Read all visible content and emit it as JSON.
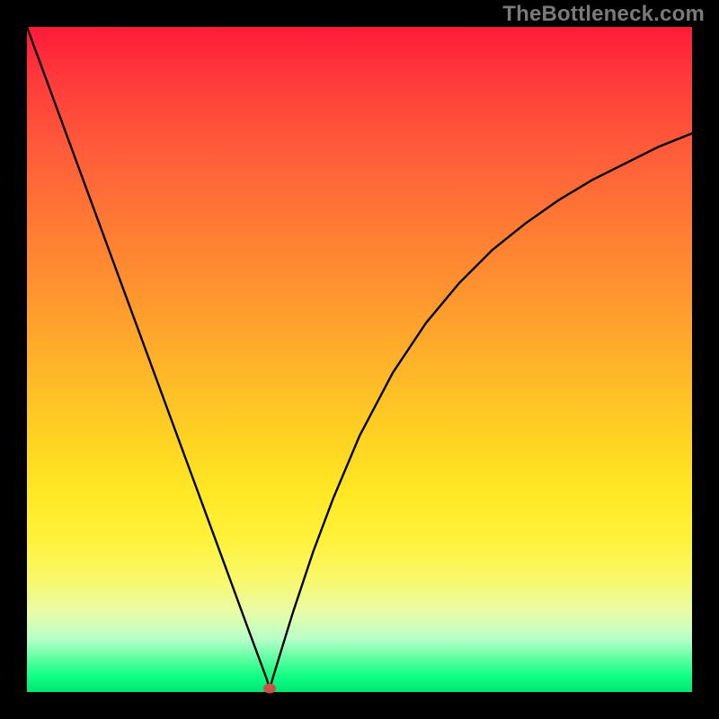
{
  "watermark": "TheBottleneck.com",
  "chart_data": {
    "type": "line",
    "title": "",
    "xlabel": "",
    "ylabel": "",
    "xlim": [
      0,
      100
    ],
    "ylim": [
      0,
      100
    ],
    "series": [
      {
        "name": "curve",
        "x": [
          0,
          5,
          10,
          15,
          20,
          25,
          30,
          33,
          35,
          36,
          36.5,
          37,
          38,
          40,
          43,
          46,
          50,
          55,
          60,
          65,
          70,
          75,
          80,
          85,
          90,
          95,
          100
        ],
        "y": [
          100,
          86.4,
          72.8,
          59.2,
          45.6,
          32.0,
          18.4,
          10.2,
          4.8,
          2.1,
          0.5,
          2.2,
          5.5,
          12.0,
          21.0,
          29.0,
          38.5,
          48.0,
          55.5,
          61.5,
          66.5,
          70.5,
          74.0,
          77.0,
          79.5,
          82.0,
          84.0
        ]
      }
    ],
    "marker": {
      "x": 36.5,
      "y": 0.5
    },
    "gradient_stops": [
      {
        "t": 0,
        "color": "#ff1a3a"
      },
      {
        "t": 50,
        "color": "#ffaa22"
      },
      {
        "t": 80,
        "color": "#fff23a"
      },
      {
        "t": 100,
        "color": "#00e673"
      }
    ]
  }
}
